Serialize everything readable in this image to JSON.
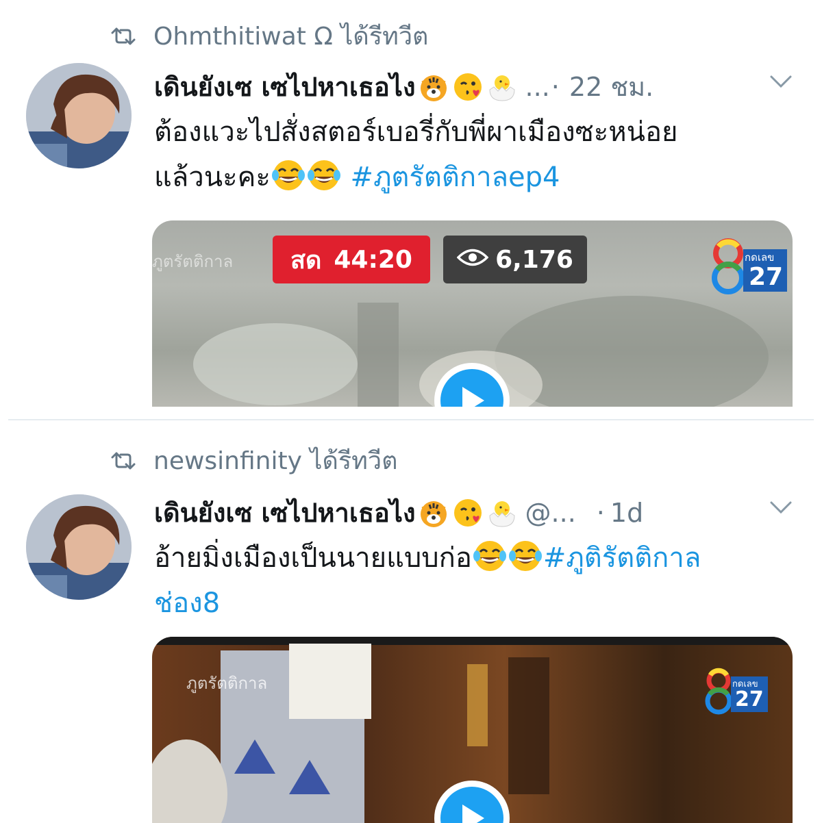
{
  "colors": {
    "text": "#14171a",
    "muted": "#657786",
    "link": "#1b95e0",
    "live": "#e0202e",
    "play": "#1da1f2"
  },
  "tweets": [
    {
      "retweeted_by": "Ohmthitiwat Ω ได้รีทวีต",
      "display_name": "เดินยังเซ เซไปหาเธอไง",
      "name_emojis": [
        "tiger-face",
        "face-blowing-kiss",
        "hatching-chick"
      ],
      "handle": "...",
      "separator": "·",
      "time": "22 ชม.",
      "text_parts": {
        "line1": "ต้องแวะไปสั่งสตอร์เบอรี่กับพี่ผาเมืองซะหน่อย",
        "line2": "แล้วนะคะ",
        "hashtag": "#ภูตรัตติกาลep4"
      },
      "text_emojis": [
        "face-with-tears-of-joy",
        "face-with-tears-of-joy"
      ],
      "media": {
        "live_label": "สด",
        "live_time": "44:20",
        "view_count": "6,176",
        "channel": "27",
        "channel_small": "กดเลข",
        "overlay_text": "ภูตรัตติกาล"
      }
    },
    {
      "retweeted_by": "newsinfinity ได้รีทวีต",
      "display_name": "เดินยังเซ เซไปหาเธอไง",
      "name_emojis": [
        "tiger-face",
        "face-blowing-kiss",
        "hatching-chick"
      ],
      "handle": "@...",
      "separator": "·",
      "time": "1d",
      "text_parts": {
        "line1": "อ้ายมิ่งเมืองเป็นนายแบบก่อ",
        "hashtag": "#ภูติรัตติกาล",
        "hashtag_cont": "ช่อง8"
      },
      "text_emojis": [
        "face-with-tears-of-joy",
        "face-with-tears-of-joy"
      ],
      "media": {
        "channel": "27",
        "channel_small": "กดเลข",
        "overlay_text": "ภูตรัตติกาล"
      }
    }
  ]
}
